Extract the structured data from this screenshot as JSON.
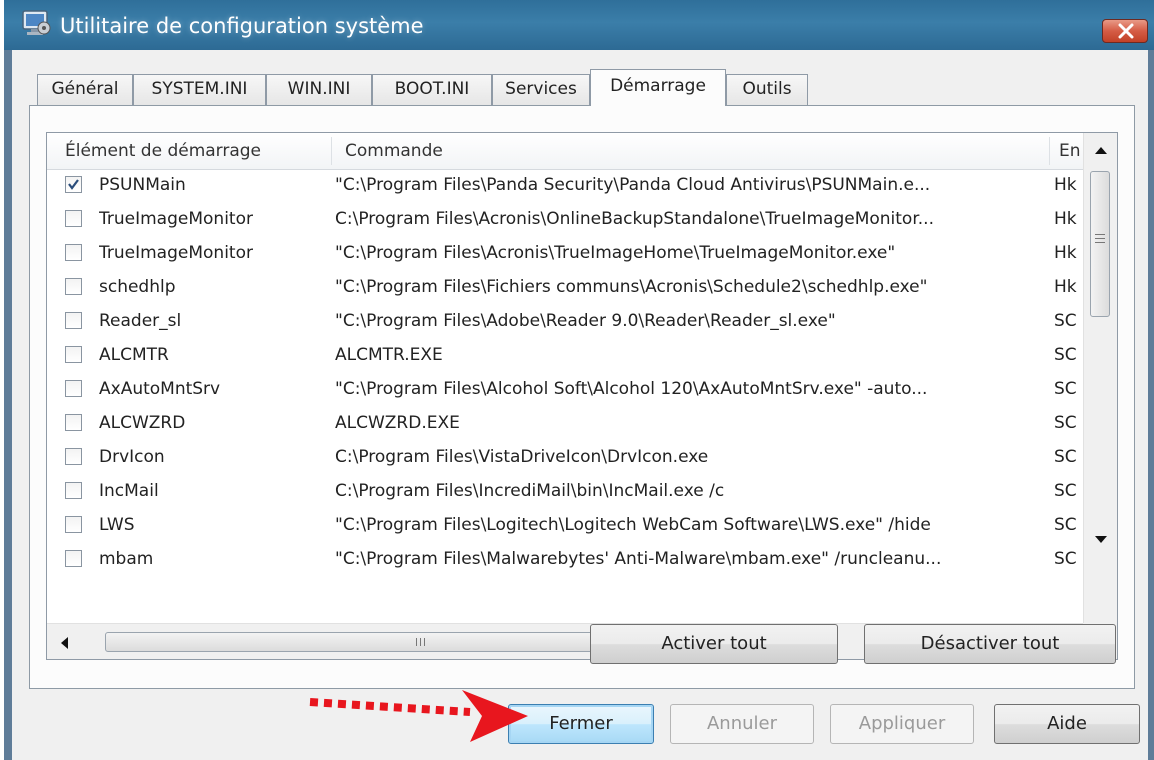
{
  "window": {
    "title": "Utilitaire de configuration système",
    "close_icon": "close-icon"
  },
  "tabs": [
    {
      "label": "Général"
    },
    {
      "label": "SYSTEM.INI"
    },
    {
      "label": "WIN.INI"
    },
    {
      "label": "BOOT.INI"
    },
    {
      "label": "Services"
    },
    {
      "label": "Démarrage",
      "active": true
    },
    {
      "label": "Outils"
    }
  ],
  "startup_list": {
    "columns": [
      "Élément de démarrage",
      "Commande",
      "En"
    ],
    "rows": [
      {
        "checked": true,
        "item": "PSUNMain",
        "command": "\"C:\\Program Files\\Panda Security\\Panda Cloud Antivirus\\PSUNMain.e...",
        "location": "Hk"
      },
      {
        "checked": false,
        "item": "TrueImageMonitor",
        "command": "C:\\Program Files\\Acronis\\OnlineBackupStandalone\\TrueImageMonitor...",
        "location": "Hk"
      },
      {
        "checked": false,
        "item": "TrueImageMonitor",
        "command": "\"C:\\Program Files\\Acronis\\TrueImageHome\\TrueImageMonitor.exe\"",
        "location": "Hk"
      },
      {
        "checked": false,
        "item": "schedhlp",
        "command": "\"C:\\Program Files\\Fichiers communs\\Acronis\\Schedule2\\schedhlp.exe\"",
        "location": "Hk"
      },
      {
        "checked": false,
        "item": "Reader_sl",
        "command": "\"C:\\Program Files\\Adobe\\Reader 9.0\\Reader\\Reader_sl.exe\"",
        "location": "SC"
      },
      {
        "checked": false,
        "item": "ALCMTR",
        "command": "ALCMTR.EXE",
        "location": "SC"
      },
      {
        "checked": false,
        "item": "AxAutoMntSrv",
        "command": "\"C:\\Program Files\\Alcohol Soft\\Alcohol 120\\AxAutoMntSrv.exe\" -auto...",
        "location": "SC"
      },
      {
        "checked": false,
        "item": "ALCWZRD",
        "command": "ALCWZRD.EXE",
        "location": "SC"
      },
      {
        "checked": false,
        "item": "DrvIcon",
        "command": "C:\\Program Files\\VistaDriveIcon\\DrvIcon.exe",
        "location": "SC"
      },
      {
        "checked": false,
        "item": "IncMail",
        "command": "C:\\Program Files\\IncrediMail\\bin\\IncMail.exe /c",
        "location": "SC"
      },
      {
        "checked": false,
        "item": "LWS",
        "command": "\"C:\\Program Files\\Logitech\\Logitech WebCam Software\\LWS.exe\" /hide",
        "location": "SC"
      },
      {
        "checked": false,
        "item": "mbam",
        "command": "\"C:\\Program Files\\Malwarebytes' Anti-Malware\\mbam.exe\" /runcleanu...",
        "location": "SC"
      }
    ]
  },
  "buttons": {
    "enable_all": "Activer tout",
    "disable_all": "Désactiver tout",
    "close": "Fermer",
    "cancel": "Annuler",
    "apply": "Appliquer",
    "help": "Aide"
  },
  "annotation": {
    "color": "#e8161e",
    "points_to": "Fermer"
  }
}
